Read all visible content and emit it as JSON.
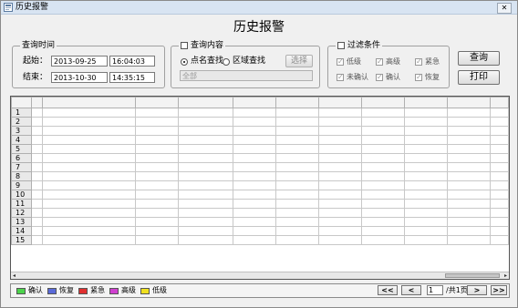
{
  "window": {
    "title": "历史报警",
    "close_glyph": "✕"
  },
  "page": {
    "title": "历史报警"
  },
  "time_group": {
    "legend": "查询时间",
    "start_label": "起始：",
    "start_date": "2013-09-25",
    "start_time": "16:04:03",
    "end_label": "结束：",
    "end_date": "2013-10-30",
    "end_time": "14:35:15"
  },
  "content_group": {
    "legend": "查询内容",
    "option_point": "点名查找",
    "option_area": "区域查找",
    "select_button": "选择",
    "text_value": "全部"
  },
  "filter_group": {
    "legend": "过滤条件",
    "items": [
      "低级",
      "高级",
      "紧急",
      "未确认",
      "确认",
      "恢复"
    ]
  },
  "buttons": {
    "query": "查询",
    "print": "打印"
  },
  "grid": {
    "row_numbers": [
      "1",
      "2",
      "3",
      "4",
      "5",
      "6",
      "7",
      "8",
      "9",
      "10",
      "11",
      "12",
      "13",
      "14",
      "15"
    ]
  },
  "status_legend": [
    {
      "label": "确认",
      "color": "#4cd44c"
    },
    {
      "label": "恢复",
      "color": "#5a6ad8"
    },
    {
      "label": "紧急",
      "color": "#e03030"
    },
    {
      "label": "高级",
      "color": "#d040d0"
    },
    {
      "label": "低级",
      "color": "#f0e020"
    }
  ],
  "pager": {
    "first": "<<",
    "prev": "<",
    "page_value": "1",
    "page_info": "/共1页",
    "next": ">",
    "last": ">>"
  },
  "scroll": {
    "left": "◂",
    "right": "▸"
  }
}
